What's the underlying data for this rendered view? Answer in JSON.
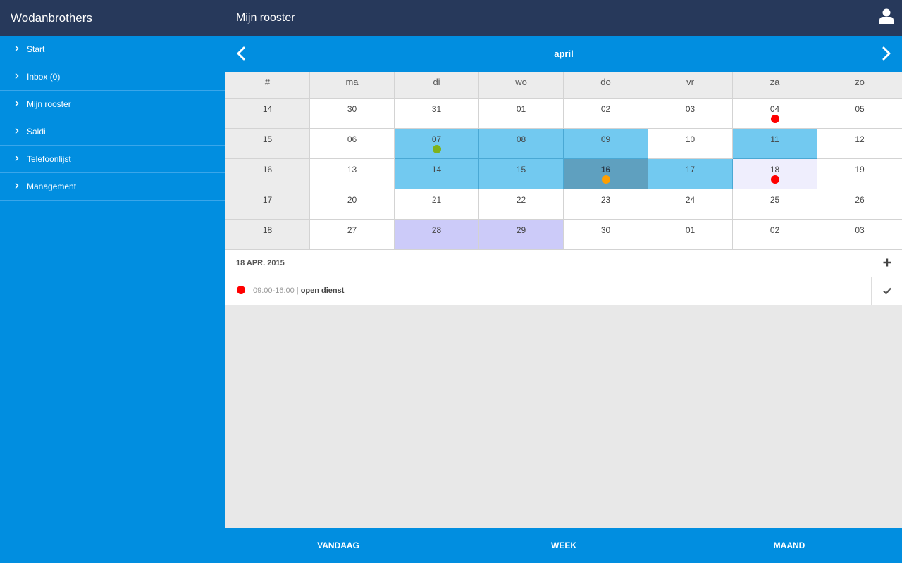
{
  "sidebar": {
    "app_title": "Wodanbrothers",
    "items": [
      {
        "label": "Start"
      },
      {
        "label": "Inbox (0)"
      },
      {
        "label": "Mijn rooster"
      },
      {
        "label": "Saldi"
      },
      {
        "label": "Telefoonlijst"
      },
      {
        "label": "Management"
      }
    ]
  },
  "header": {
    "title": "Mijn rooster",
    "user_icon": "user-icon"
  },
  "month_nav": {
    "label": "april",
    "prev_icon": "chevron-left-icon",
    "next_icon": "chevron-right-icon"
  },
  "calendar": {
    "headers": [
      "#",
      "ma",
      "di",
      "wo",
      "do",
      "vr",
      "za",
      "zo"
    ],
    "weeks": [
      {
        "week": "14",
        "days": [
          {
            "d": "30"
          },
          {
            "d": "31"
          },
          {
            "d": "01"
          },
          {
            "d": "02"
          },
          {
            "d": "03"
          },
          {
            "d": "04",
            "dot": "#ff0000"
          },
          {
            "d": "05"
          }
        ]
      },
      {
        "week": "15",
        "days": [
          {
            "d": "06"
          },
          {
            "d": "07",
            "state": "sel",
            "dot": "#7fb21b"
          },
          {
            "d": "08",
            "state": "sel"
          },
          {
            "d": "09",
            "state": "sel"
          },
          {
            "d": "10"
          },
          {
            "d": "11",
            "state": "sel"
          },
          {
            "d": "12"
          }
        ]
      },
      {
        "week": "16",
        "days": [
          {
            "d": "13"
          },
          {
            "d": "14",
            "state": "sel"
          },
          {
            "d": "15",
            "state": "sel"
          },
          {
            "d": "16",
            "state": "today",
            "dot": "#ff9e00"
          },
          {
            "d": "17",
            "state": "sel"
          },
          {
            "d": "18",
            "state": "lavender",
            "dot": "#ff0000"
          },
          {
            "d": "19"
          }
        ]
      },
      {
        "week": "17",
        "days": [
          {
            "d": "20"
          },
          {
            "d": "21"
          },
          {
            "d": "22"
          },
          {
            "d": "23"
          },
          {
            "d": "24"
          },
          {
            "d": "25"
          },
          {
            "d": "26"
          }
        ]
      },
      {
        "week": "18",
        "days": [
          {
            "d": "27"
          },
          {
            "d": "28",
            "state": "purple"
          },
          {
            "d": "29",
            "state": "purple"
          },
          {
            "d": "30"
          },
          {
            "d": "01"
          },
          {
            "d": "02"
          },
          {
            "d": "03"
          }
        ]
      }
    ]
  },
  "day_detail": {
    "date": "18 APR. 2015",
    "add_icon": "plus-icon",
    "events": [
      {
        "time": "09:00-16:00",
        "separator": "|",
        "title": "open dienst",
        "dot_color": "#ff0000",
        "check_icon": "check-icon"
      }
    ]
  },
  "bottom_bar": {
    "today": "VANDAAG",
    "week": "WEEK",
    "month": "MAAND"
  },
  "colors": {
    "accent": "#018ee0",
    "header_dark": "#27395b",
    "selected": "#72c9f0",
    "today": "#5fa0bf",
    "purple": "#cccbf9"
  }
}
